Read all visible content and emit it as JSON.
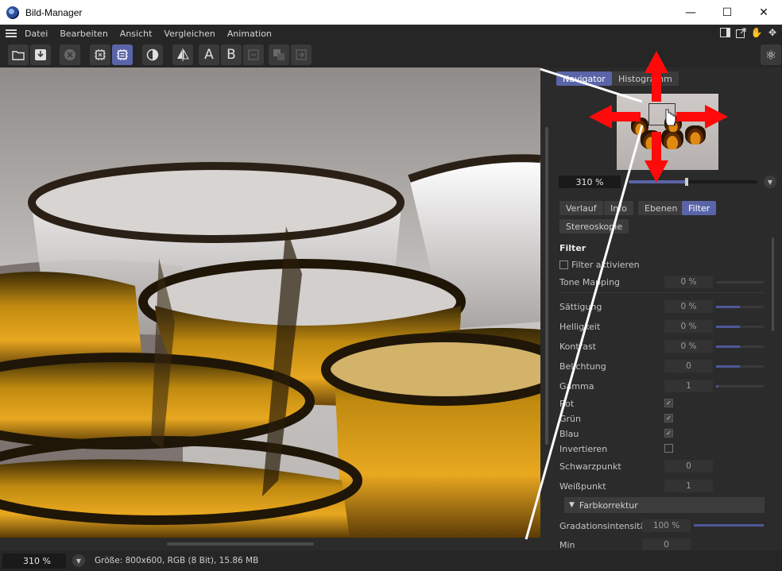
{
  "window": {
    "title": "Bild-Manager",
    "min": "—",
    "max": "☐",
    "close": "✕"
  },
  "menu": [
    "Datei",
    "Bearbeiten",
    "Ansicht",
    "Vergleichen",
    "Animation"
  ],
  "toolbar": {
    "a_label": "A",
    "b_label": "B"
  },
  "navigator": {
    "tabs": [
      "Navigator",
      "Histogramm"
    ],
    "zoom_value": "310 %",
    "zoom_fraction": 0.45
  },
  "panel_tabs": [
    "Verlauf",
    "Info",
    "Ebenen",
    "Filter",
    "Stereoskopie"
  ],
  "filter": {
    "section_title": "Filter",
    "enable_label": "Filter aktivieren",
    "rows": [
      {
        "label": "Tone Mapping",
        "value": "0 %",
        "fill": 0
      },
      {
        "label": "Sättigung",
        "value": "0 %",
        "fill": 0.5
      },
      {
        "label": "Helligkeit",
        "value": "0 %",
        "fill": 0.5
      },
      {
        "label": "Kontrast",
        "value": "0 %",
        "fill": 0.5
      },
      {
        "label": "Belichtung",
        "value": "0",
        "fill": 0.5
      },
      {
        "label": "Gamma",
        "value": "1",
        "fill": 0.05
      }
    ],
    "channels": [
      {
        "label": "Rot",
        "checked": true
      },
      {
        "label": "Grün",
        "checked": true
      },
      {
        "label": "Blau",
        "checked": true
      },
      {
        "label": "Invertieren",
        "checked": false
      }
    ],
    "schwarzpunkt_label": "Schwarzpunkt",
    "schwarzpunkt_value": "0",
    "weisspunkt_label": "Weißpunkt",
    "weisspunkt_value": "1",
    "farbkorrektur_label": "Farbkorrektur",
    "gradation_label": "Gradationsintensität",
    "gradation_value": "100 %",
    "gradation_fill": 1.0,
    "min_label": "Min",
    "min_value": "0"
  },
  "status": {
    "zoom_value": "310 %",
    "info": "Größe: 800x600, RGB (8 Bit), 15.86 MB"
  }
}
